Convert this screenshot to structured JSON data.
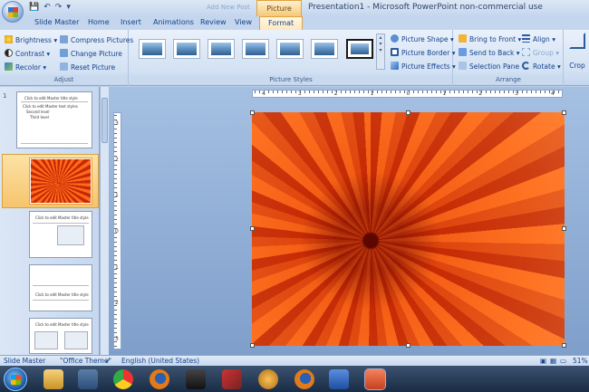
{
  "titlebar": {
    "faded_title": "Add New Post",
    "contextual_tab": "Picture Tools",
    "app_title": "Presentation1 - Microsoft PowerPoint non-commercial use",
    "qat": [
      "💾",
      "↶",
      "↷",
      "▾"
    ]
  },
  "tabs": [
    "Slide Master",
    "Home",
    "Insert",
    "Animations",
    "Review",
    "View",
    "Format"
  ],
  "ribbon": {
    "adjust": {
      "label": "Adjust",
      "brightness": "Brightness ▾",
      "contrast": "Contrast ▾",
      "recolor": "Recolor ▾",
      "compress": "Compress Pictures",
      "change": "Change Picture",
      "reset": "Reset Picture"
    },
    "picture_styles": {
      "label": "Picture Styles",
      "shape": "Picture Shape ▾",
      "border": "Picture Border ▾",
      "effects": "Picture Effects ▾"
    },
    "arrange": {
      "label": "Arrange",
      "bring_front": "Bring to Front ▾",
      "send_back": "Send to Back ▾",
      "selection_pane": "Selection Pane",
      "align": "Align ▾",
      "group": "Group ▾",
      "rotate": "Rotate ▾"
    },
    "crop": "Crop"
  },
  "slides": {
    "first_number": "1",
    "master_title": "Click to edit Master title style",
    "layout_title": "Click to edit Master title style",
    "thumb_text": "Click to edit Master text styles",
    "second_level": "Second level",
    "third_level": "Third level"
  },
  "hruler": [
    "4",
    "3",
    "2",
    "1",
    "0",
    "1",
    "2",
    "3",
    "4"
  ],
  "vruler": [
    "3",
    "2",
    "1",
    "0",
    "1",
    "2",
    "3"
  ],
  "status": {
    "view": "Slide Master",
    "theme": "\"Office Theme\"",
    "language": "English (United States)",
    "zoom": "51%"
  },
  "colors": {
    "ribbon": "#d2e1f3",
    "contextual": "#f6c875",
    "flower": "#e5501a"
  }
}
